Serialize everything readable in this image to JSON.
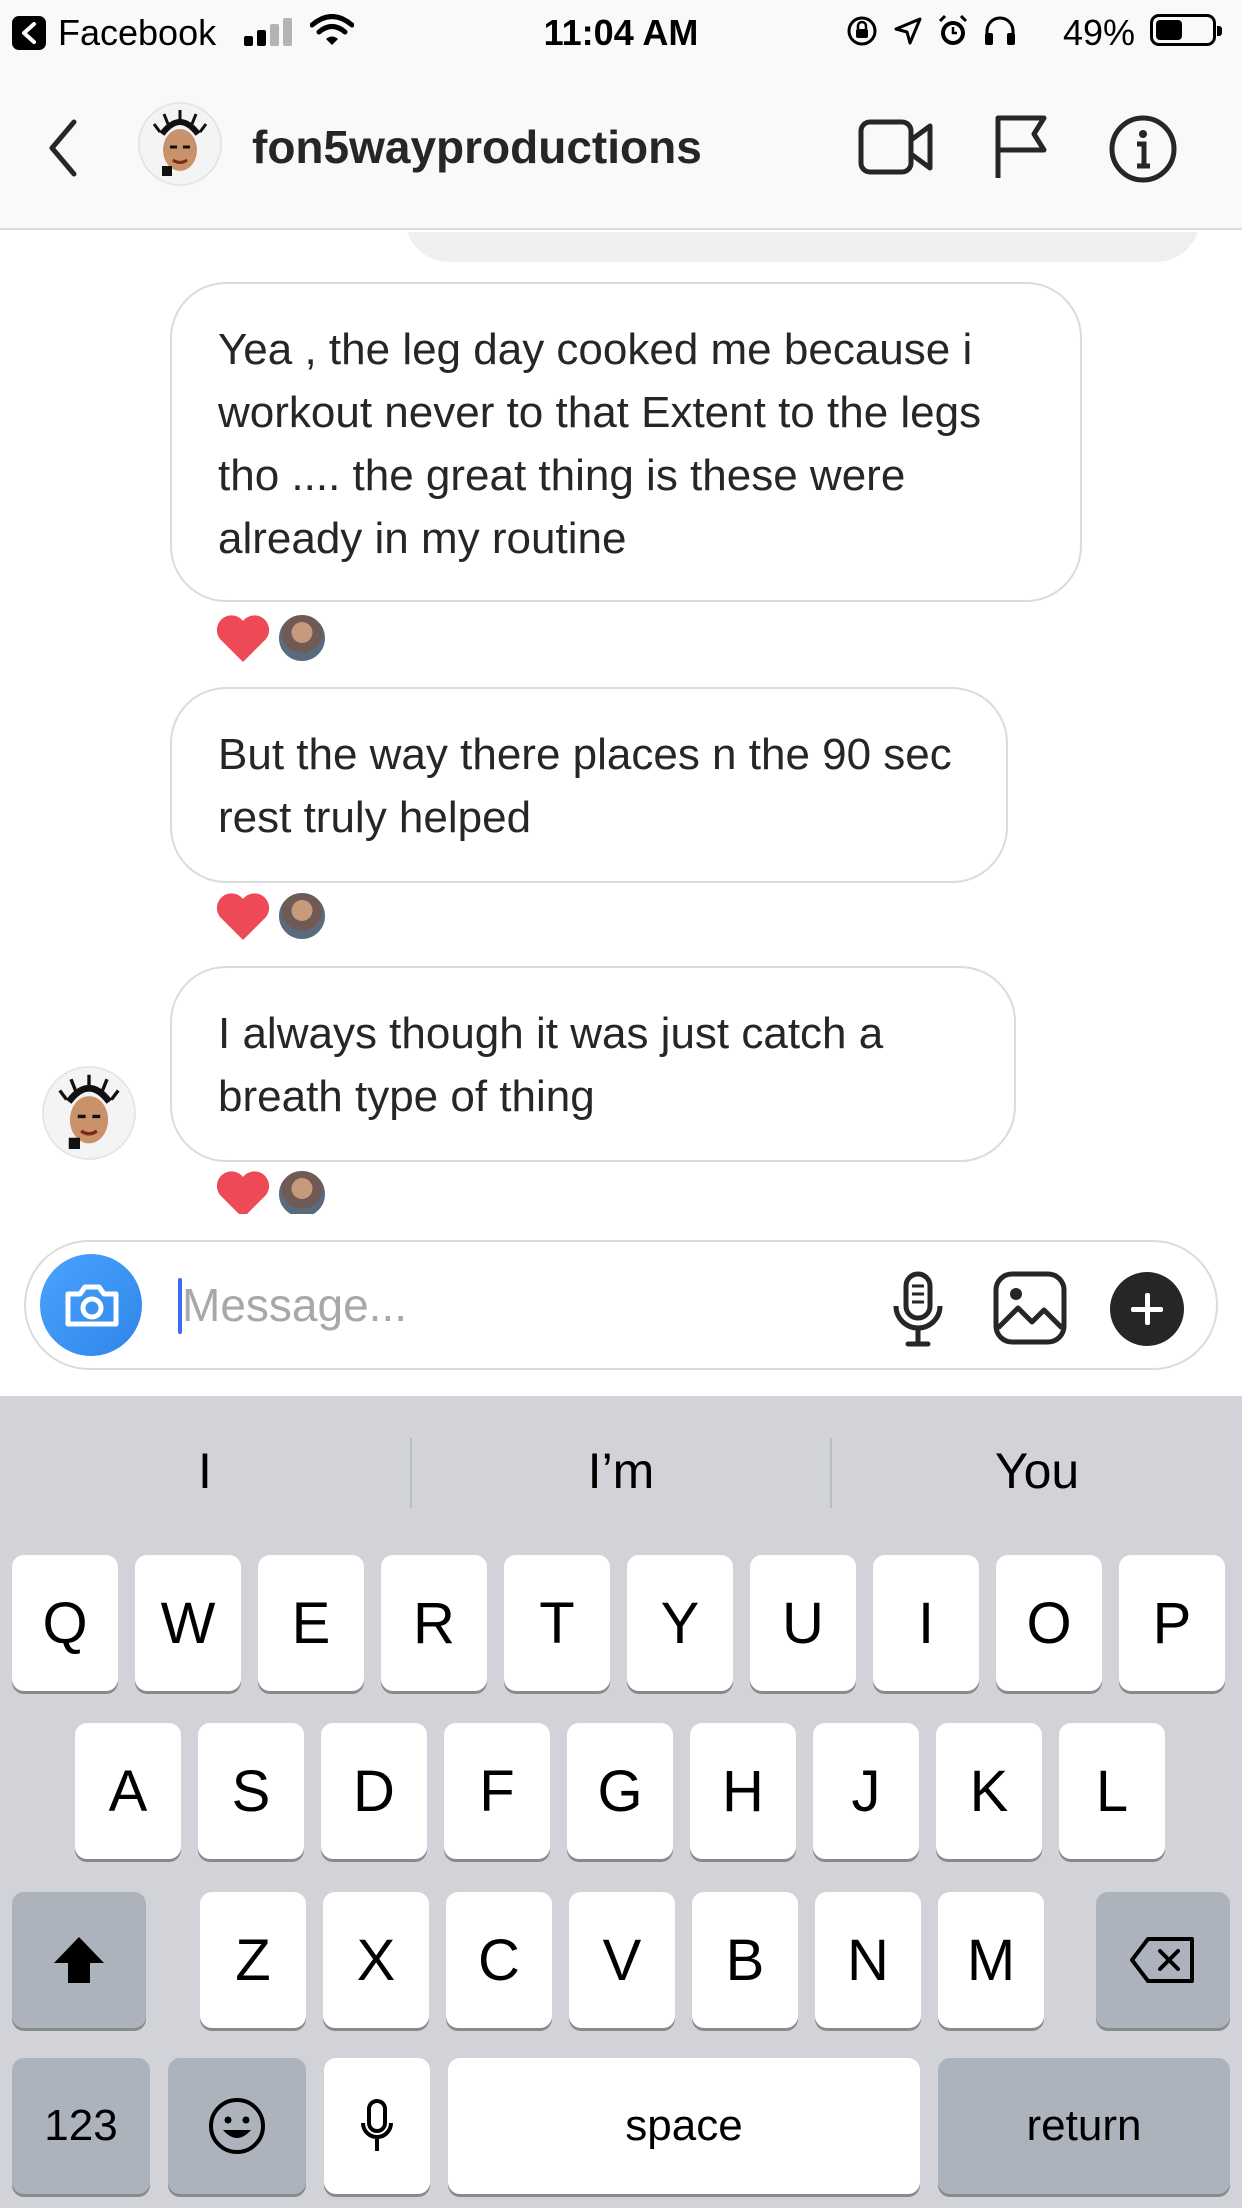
{
  "status_bar": {
    "back_app": "Facebook",
    "time": "11:04 AM",
    "battery_percent": "49%",
    "battery_level": 0.49,
    "signal_bars": 2
  },
  "header": {
    "username": "fon5wayproductions",
    "icons": [
      "back-chevron-icon",
      "video-call-icon",
      "report-flag-icon",
      "info-icon"
    ]
  },
  "messages": [
    {
      "text": "Yea , the leg day cooked me because i workout never to that   Extent to the legs tho .... the great thing is these were already in my routine",
      "reaction": "heart"
    },
    {
      "text": "But the way there places n the 90 sec rest truly helped",
      "reaction": "heart"
    },
    {
      "text": "I always though it was just catch a breath type of thing",
      "reaction": "heart"
    }
  ],
  "composer": {
    "placeholder": "Message...",
    "value": ""
  },
  "keyboard": {
    "suggestions": [
      "I",
      "I’m",
      "You"
    ],
    "row1": [
      "Q",
      "W",
      "E",
      "R",
      "T",
      "Y",
      "U",
      "I",
      "O",
      "P"
    ],
    "row2": [
      "A",
      "S",
      "D",
      "F",
      "G",
      "H",
      "J",
      "K",
      "L"
    ],
    "row3": [
      "Z",
      "X",
      "C",
      "V",
      "B",
      "N",
      "M"
    ],
    "numbers_key": "123",
    "space_key": "space",
    "return_key": "return"
  },
  "colors": {
    "accent_blue": "#3897f0",
    "heart_red": "#ed4956",
    "keyboard_bg": "#d1d3d9"
  }
}
